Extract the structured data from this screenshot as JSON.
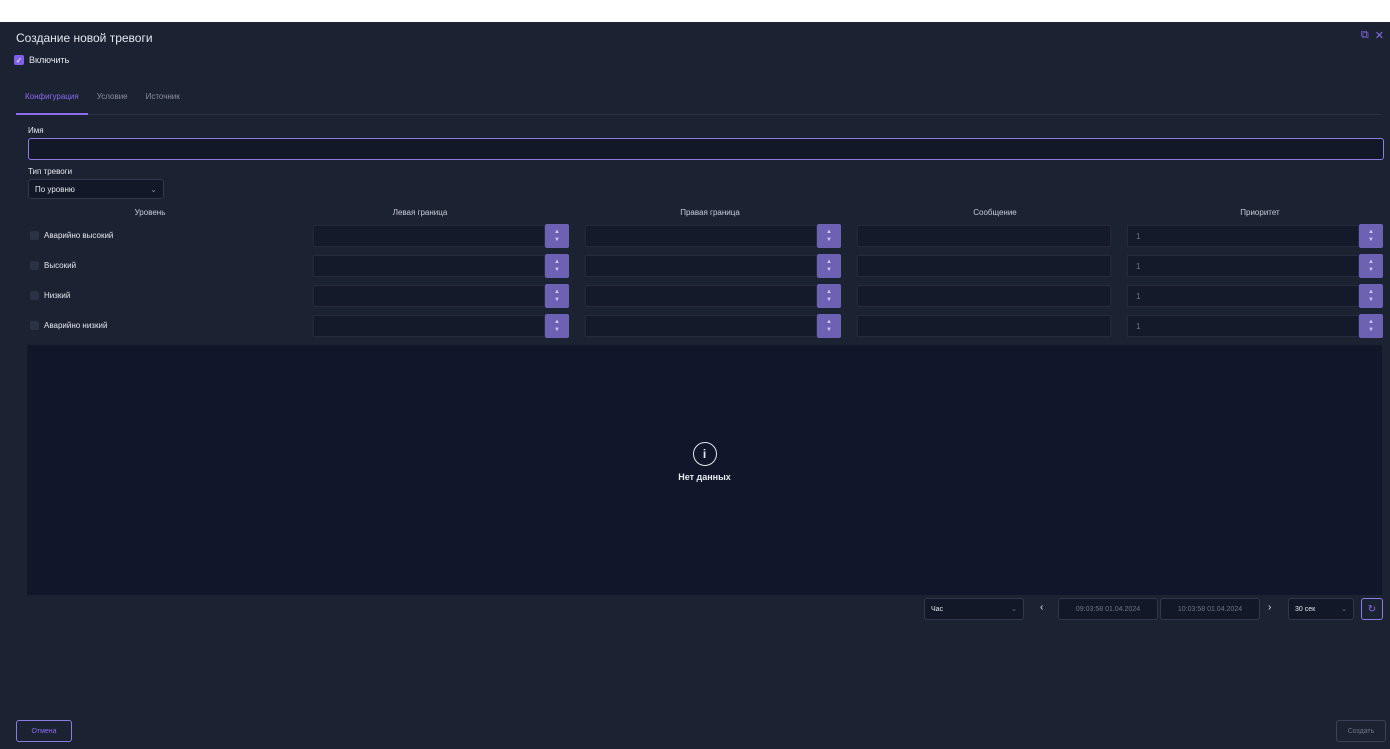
{
  "window": {
    "title": "Создание новой тревоги"
  },
  "enable": {
    "label": "Включить",
    "checked": true
  },
  "tabs": [
    {
      "label": "Конфигурация",
      "active": true
    },
    {
      "label": "Условие",
      "active": false
    },
    {
      "label": "Источник",
      "active": false
    }
  ],
  "name_field": {
    "label": "Имя",
    "value": ""
  },
  "alarm_type": {
    "label": "Тип тревоги",
    "value": "По уровню"
  },
  "table": {
    "headers": {
      "level": "Уровень",
      "left": "Левая граница",
      "right": "Правая граница",
      "message": "Сообщение",
      "priority": "Приоритет"
    },
    "rows": [
      {
        "level": "Аварийно высокий",
        "left": "",
        "right": "",
        "message": "",
        "priority": "1"
      },
      {
        "level": "Высокий",
        "left": "",
        "right": "",
        "message": "",
        "priority": "1"
      },
      {
        "level": "Низкий",
        "left": "",
        "right": "",
        "message": "",
        "priority": "1"
      },
      {
        "level": "Аварийно низкий",
        "left": "",
        "right": "",
        "message": "",
        "priority": "1"
      }
    ]
  },
  "chart": {
    "empty_text": "Нет данных"
  },
  "range": {
    "period": "Час",
    "from": "09:03:58 01.04.2024",
    "to": "10:03:58 01.04.2024",
    "interval": "30 сек"
  },
  "buttons": {
    "cancel": "Отмена",
    "create": "Создать"
  },
  "colors": {
    "accent": "#8a6cf0",
    "background": "#1b2231",
    "stepper": "#6d61b4"
  }
}
